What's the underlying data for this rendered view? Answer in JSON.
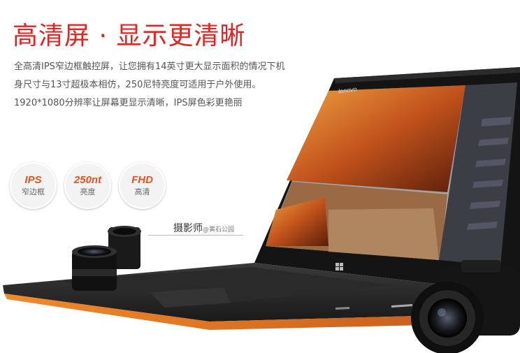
{
  "headline": "高清屏 · 显示更清晰",
  "description": [
    "全高清IPS窄边框触控屏，让您拥有14英寸更大显示面积的情况下机",
    "身尺寸与13寸超极本相仿，250尼特亮度可适用于户外使用。",
    "1920*1080分辨率让屏幕更显示清晰，IPS屏色彩更艳丽"
  ],
  "badges": [
    {
      "value": "IPS",
      "label": "窄边框"
    },
    {
      "value": "250nt",
      "label": "亮度"
    },
    {
      "value": "FHD",
      "label": "高清"
    }
  ],
  "photo_credit": {
    "name": "摄影师",
    "location": "@黄石公园"
  },
  "laptop_brand": "lenovo",
  "colors": {
    "accent": "#e8221f",
    "badge_text": "#e8521f",
    "laptop_edge": "#e87a1e"
  }
}
